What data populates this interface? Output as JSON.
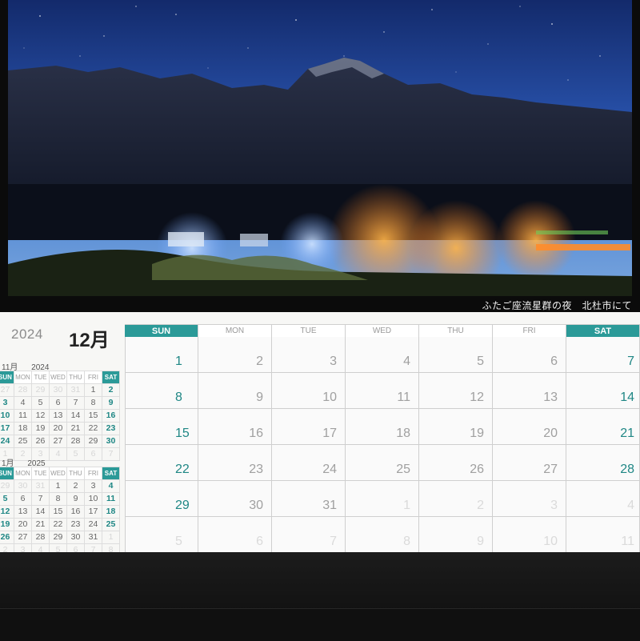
{
  "caption": "ふたご座流星群の夜　北杜市にて",
  "calendar": {
    "year": "2024",
    "month": "12月",
    "weekdays": [
      "SUN",
      "MON",
      "TUE",
      "WED",
      "THU",
      "FRI",
      "SAT"
    ],
    "weeks": [
      [
        {
          "d": "1"
        },
        {
          "d": "2"
        },
        {
          "d": "3"
        },
        {
          "d": "4"
        },
        {
          "d": "5"
        },
        {
          "d": "6"
        },
        {
          "d": "7"
        }
      ],
      [
        {
          "d": "8"
        },
        {
          "d": "9"
        },
        {
          "d": "10"
        },
        {
          "d": "11"
        },
        {
          "d": "12"
        },
        {
          "d": "13"
        },
        {
          "d": "14"
        }
      ],
      [
        {
          "d": "15"
        },
        {
          "d": "16"
        },
        {
          "d": "17"
        },
        {
          "d": "18"
        },
        {
          "d": "19"
        },
        {
          "d": "20"
        },
        {
          "d": "21"
        }
      ],
      [
        {
          "d": "22"
        },
        {
          "d": "23"
        },
        {
          "d": "24"
        },
        {
          "d": "25"
        },
        {
          "d": "26"
        },
        {
          "d": "27"
        },
        {
          "d": "28"
        }
      ],
      [
        {
          "d": "29"
        },
        {
          "d": "30"
        },
        {
          "d": "31"
        },
        {
          "d": "1",
          "out": true
        },
        {
          "d": "2",
          "out": true
        },
        {
          "d": "3",
          "out": true
        },
        {
          "d": "4",
          "out": true
        }
      ],
      [
        {
          "d": "5",
          "out": true
        },
        {
          "d": "6",
          "out": true
        },
        {
          "d": "7",
          "out": true
        },
        {
          "d": "8",
          "out": true
        },
        {
          "d": "9",
          "out": true
        },
        {
          "d": "10",
          "out": true
        },
        {
          "d": "11",
          "out": true
        }
      ]
    ]
  },
  "mini_prev": {
    "month": "11月",
    "year": "2024",
    "weekdays": [
      "SUN",
      "MON",
      "TUE",
      "WED",
      "THU",
      "FRI",
      "SAT"
    ],
    "weeks": [
      [
        {
          "d": "27",
          "out": true
        },
        {
          "d": "28",
          "out": true
        },
        {
          "d": "29",
          "out": true
        },
        {
          "d": "30",
          "out": true
        },
        {
          "d": "31",
          "out": true
        },
        {
          "d": "1"
        },
        {
          "d": "2"
        }
      ],
      [
        {
          "d": "3"
        },
        {
          "d": "4"
        },
        {
          "d": "5"
        },
        {
          "d": "6"
        },
        {
          "d": "7"
        },
        {
          "d": "8"
        },
        {
          "d": "9"
        }
      ],
      [
        {
          "d": "10"
        },
        {
          "d": "11"
        },
        {
          "d": "12"
        },
        {
          "d": "13"
        },
        {
          "d": "14"
        },
        {
          "d": "15"
        },
        {
          "d": "16"
        }
      ],
      [
        {
          "d": "17"
        },
        {
          "d": "18"
        },
        {
          "d": "19"
        },
        {
          "d": "20"
        },
        {
          "d": "21"
        },
        {
          "d": "22"
        },
        {
          "d": "23"
        }
      ],
      [
        {
          "d": "24"
        },
        {
          "d": "25"
        },
        {
          "d": "26"
        },
        {
          "d": "27"
        },
        {
          "d": "28"
        },
        {
          "d": "29"
        },
        {
          "d": "30"
        }
      ],
      [
        {
          "d": "1",
          "out": true
        },
        {
          "d": "2",
          "out": true
        },
        {
          "d": "3",
          "out": true
        },
        {
          "d": "4",
          "out": true
        },
        {
          "d": "5",
          "out": true
        },
        {
          "d": "6",
          "out": true
        },
        {
          "d": "7",
          "out": true
        }
      ]
    ]
  },
  "mini_next": {
    "month": "1月",
    "year": "2025",
    "weekdays": [
      "SUN",
      "MON",
      "TUE",
      "WED",
      "THU",
      "FRI",
      "SAT"
    ],
    "weeks": [
      [
        {
          "d": "29",
          "out": true
        },
        {
          "d": "30",
          "out": true
        },
        {
          "d": "31",
          "out": true
        },
        {
          "d": "1"
        },
        {
          "d": "2"
        },
        {
          "d": "3"
        },
        {
          "d": "4"
        }
      ],
      [
        {
          "d": "5"
        },
        {
          "d": "6"
        },
        {
          "d": "7"
        },
        {
          "d": "8"
        },
        {
          "d": "9"
        },
        {
          "d": "10"
        },
        {
          "d": "11"
        }
      ],
      [
        {
          "d": "12"
        },
        {
          "d": "13"
        },
        {
          "d": "14"
        },
        {
          "d": "15"
        },
        {
          "d": "16"
        },
        {
          "d": "17"
        },
        {
          "d": "18"
        }
      ],
      [
        {
          "d": "19"
        },
        {
          "d": "20"
        },
        {
          "d": "21"
        },
        {
          "d": "22"
        },
        {
          "d": "23"
        },
        {
          "d": "24"
        },
        {
          "d": "25"
        }
      ],
      [
        {
          "d": "26"
        },
        {
          "d": "27"
        },
        {
          "d": "28"
        },
        {
          "d": "29"
        },
        {
          "d": "30"
        },
        {
          "d": "31"
        },
        {
          "d": "1",
          "out": true
        }
      ],
      [
        {
          "d": "2",
          "out": true
        },
        {
          "d": "3",
          "out": true
        },
        {
          "d": "4",
          "out": true
        },
        {
          "d": "5",
          "out": true
        },
        {
          "d": "6",
          "out": true
        },
        {
          "d": "7",
          "out": true
        },
        {
          "d": "8",
          "out": true
        }
      ]
    ]
  },
  "colors": {
    "accent": "#2b9a98",
    "weekend_text": "#1f8785",
    "sheet": "#f7f7f5",
    "sky_top": "#1c3a86",
    "sky_bottom": "#5b8fd6"
  }
}
